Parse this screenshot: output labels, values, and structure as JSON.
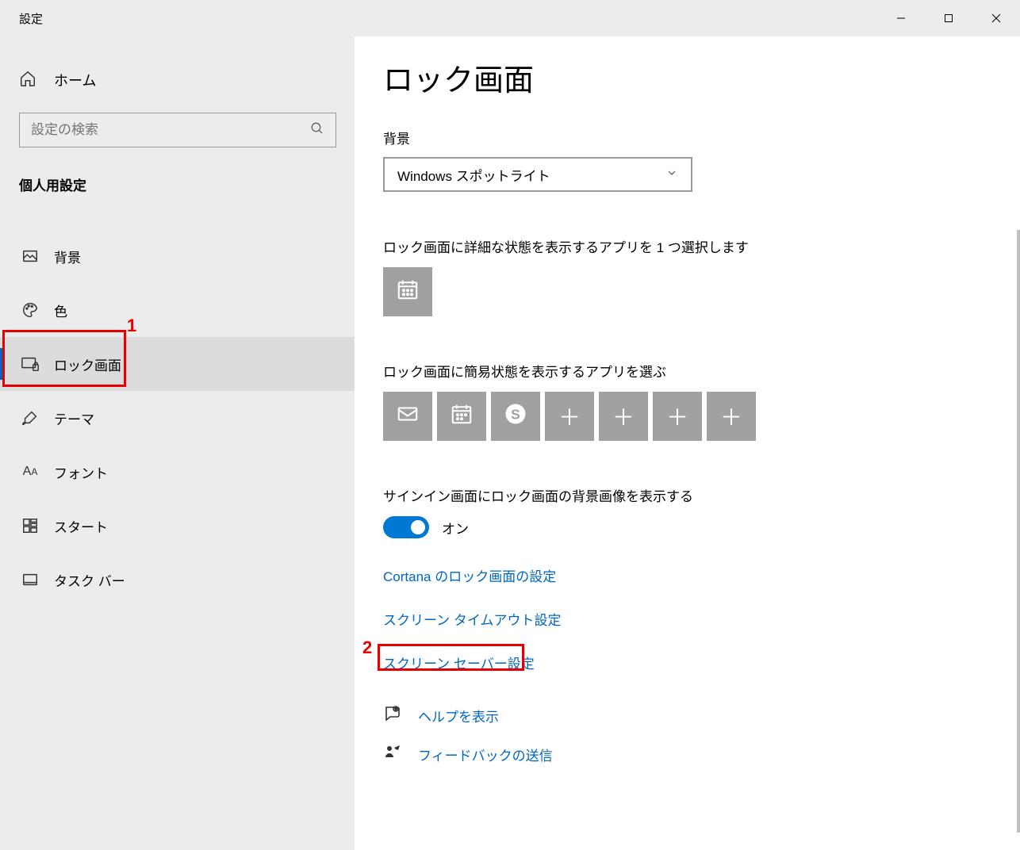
{
  "window": {
    "title": "設定"
  },
  "sidebar": {
    "home": "ホーム",
    "search_placeholder": "設定の検索",
    "section": "個人用設定",
    "items": [
      {
        "label": "背景"
      },
      {
        "label": "色"
      },
      {
        "label": "ロック画面"
      },
      {
        "label": "テーマ"
      },
      {
        "label": "フォント"
      },
      {
        "label": "スタート"
      },
      {
        "label": "タスク バー"
      }
    ]
  },
  "main": {
    "title": "ロック画面",
    "background": {
      "label": "背景",
      "value": "Windows スポットライト"
    },
    "detailed_app_label": "ロック画面に詳細な状態を表示するアプリを 1 つ選択します",
    "quick_apps_label": "ロック画面に簡易状態を表示するアプリを選ぶ",
    "signin_bg": {
      "label": "サインイン画面にロック画面の背景画像を表示する",
      "state": "オン"
    },
    "links": {
      "cortana": "Cortana のロック画面の設定",
      "timeout": "スクリーン タイムアウト設定",
      "screensaver": "スクリーン セーバー設定"
    },
    "help": {
      "show_help": "ヘルプを表示",
      "feedback": "フィードバックの送信"
    }
  },
  "annotations": {
    "a1": "1",
    "a2": "2"
  }
}
